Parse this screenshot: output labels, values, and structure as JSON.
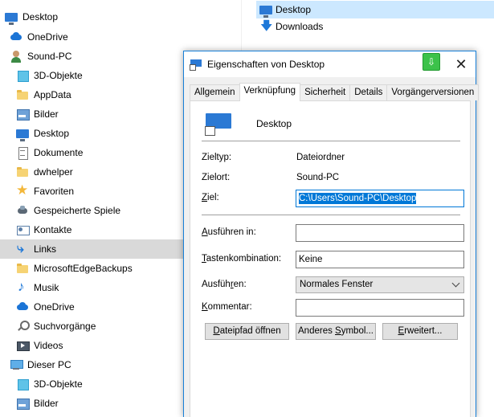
{
  "explorer": {
    "nav_items": [
      {
        "label": "Desktop",
        "icon": "desktop-icon"
      },
      {
        "label": "OneDrive",
        "icon": "onedrive-icon"
      },
      {
        "label": "Sound-PC",
        "icon": "user-icon"
      },
      {
        "label": "3D-Objekte",
        "icon": "3d-objects-icon"
      },
      {
        "label": "AppData",
        "icon": "folder-icon"
      },
      {
        "label": "Bilder",
        "icon": "pictures-icon"
      },
      {
        "label": "Desktop",
        "icon": "desktop-icon"
      },
      {
        "label": "Dokumente",
        "icon": "documents-icon"
      },
      {
        "label": "dwhelper",
        "icon": "folder-icon"
      },
      {
        "label": "Favoriten",
        "icon": "star-icon"
      },
      {
        "label": "Gespeicherte Spiele",
        "icon": "saved-games-icon"
      },
      {
        "label": "Kontakte",
        "icon": "contacts-icon"
      },
      {
        "label": "Links",
        "icon": "links-icon"
      },
      {
        "label": "MicrosoftEdgeBackups",
        "icon": "folder-icon"
      },
      {
        "label": "Musik",
        "icon": "music-icon"
      },
      {
        "label": "OneDrive",
        "icon": "onedrive-icon"
      },
      {
        "label": "Suchvorgänge",
        "icon": "search-icon"
      },
      {
        "label": "Videos",
        "icon": "videos-icon"
      },
      {
        "label": "Dieser PC",
        "icon": "this-pc-icon"
      },
      {
        "label": "3D-Objekte",
        "icon": "3d-objects-icon"
      },
      {
        "label": "Bilder",
        "icon": "pictures-icon"
      }
    ],
    "selected_nav": "Links",
    "content_items": [
      {
        "label": "Desktop",
        "icon": "desktop-shortcut-icon"
      },
      {
        "label": "Downloads",
        "icon": "downloads-shortcut-icon"
      }
    ]
  },
  "dialog": {
    "title": "Eigenschaften von Desktop",
    "tabs": [
      "Allgemein",
      "Verknüpfung",
      "Sicherheit",
      "Details",
      "Vorgängerversionen"
    ],
    "active_tab": "Verknüpfung",
    "shortcut_name": "Desktop",
    "zieltyp_label": "Zieltyp:",
    "zieltyp_value": "Dateiordner",
    "zielort_label": "Zielort:",
    "zielort_value": "Sound-PC",
    "ziel_label_prefix": "Z",
    "ziel_label_rest": "iel:",
    "ziel_value": "C:\\Users\\Sound-PC\\Desktop",
    "ausfuehren_in_label_prefix": "A",
    "ausfuehren_in_label_rest": "usführen in:",
    "ausfuehren_in_value": "",
    "tastenkombination_label_prefix": "T",
    "tastenkombination_label_rest": "astenkombination:",
    "tastenkombination_value": "Keine",
    "ausfuehren_label_prefix": "Ausfüh",
    "ausfuehren_label_ul": "r",
    "ausfuehren_label_rest": "en:",
    "ausfuehren_value": "Normales Fenster",
    "kommentar_label_prefix": "K",
    "kommentar_label_rest": "ommentar:",
    "kommentar_value": "",
    "btn_dateipfad_ul": "D",
    "btn_dateipfad_rest": "ateipfad öffnen",
    "btn_symbol_prefix": "Anderes ",
    "btn_symbol_ul": "S",
    "btn_symbol_rest": "ymbol...",
    "btn_erweitert_ul": "E",
    "btn_erweitert_rest": "rweitert...",
    "close_glyph": "✕",
    "accent_color": "#0078d7"
  }
}
